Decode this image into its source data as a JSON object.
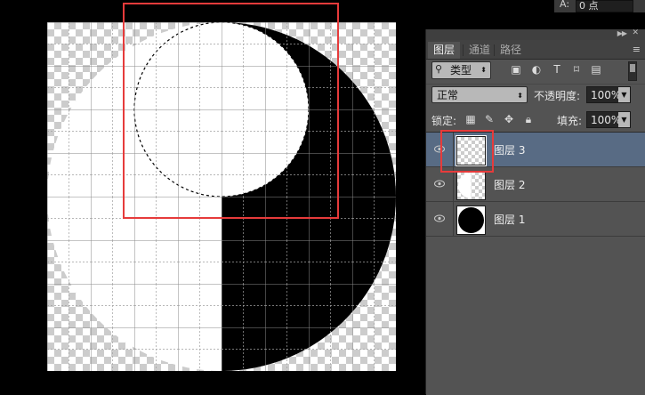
{
  "info_panel": {
    "label": "A:",
    "value": "0 点"
  },
  "layers_panel": {
    "tabs": [
      {
        "label": "图层",
        "active": true
      },
      {
        "label": "通道",
        "active": false
      },
      {
        "label": "路径",
        "active": false
      }
    ],
    "collapse_icon": "double-chevron-right-icon",
    "close_icon": "close-icon",
    "menu_icon": "panel-menu-icon",
    "filter": {
      "kind_label": "类型",
      "icons": [
        "image-filter-icon",
        "adjustment-filter-icon",
        "type-filter-icon",
        "shape-filter-icon",
        "smart-object-filter-icon"
      ]
    },
    "blend_mode": "正常",
    "opacity_label": "不透明度:",
    "opacity_value": "100%",
    "lock_label": "锁定:",
    "lock_icons": [
      "lock-transparent-pixels-icon",
      "lock-image-pixels-icon",
      "lock-position-icon",
      "lock-all-icon"
    ],
    "fill_label": "填充:",
    "fill_value": "100%",
    "layers": [
      {
        "name": "图层 3",
        "visible": true,
        "selected": true,
        "thumb": "empty"
      },
      {
        "name": "图层 2",
        "visible": true,
        "selected": false,
        "thumb": "white-half"
      },
      {
        "name": "图层 1",
        "visible": true,
        "selected": false,
        "thumb": "black-circle"
      }
    ]
  },
  "colors": {
    "highlight": "#e63b3b",
    "panel_bg": "#535353",
    "selected_row": "#586b84"
  }
}
